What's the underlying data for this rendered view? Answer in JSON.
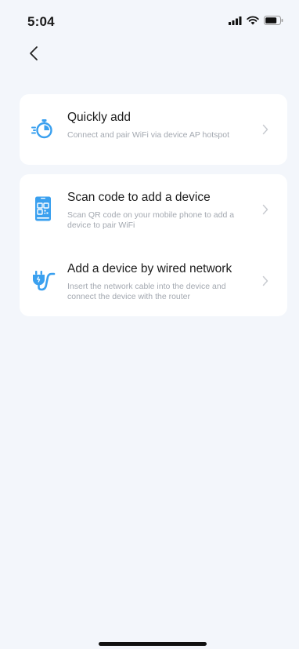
{
  "status_bar": {
    "time": "5:04",
    "icons": [
      "signal-icon",
      "wifi-icon",
      "battery-icon"
    ]
  },
  "nav": {
    "back_icon": "chevron-left-icon"
  },
  "colors": {
    "background": "#f3f6fb",
    "card": "#ffffff",
    "accent": "#3aa0ef",
    "title": "#1c1c1c",
    "description": "#a3a8b0",
    "chevron": "#c8cbd0"
  },
  "options": [
    {
      "icon": "stopwatch-icon",
      "title": "Quickly add",
      "description": "Connect and pair WiFi via device AP hotspot"
    },
    {
      "icon": "qr-code-icon",
      "title": "Scan code to add a device",
      "description": "Scan QR code on your mobile phone to add a device to pair WiFi"
    },
    {
      "icon": "wired-plug-icon",
      "title": "Add a device by wired network",
      "description": "Insert the network cable into the device and connect the device with the router"
    }
  ]
}
